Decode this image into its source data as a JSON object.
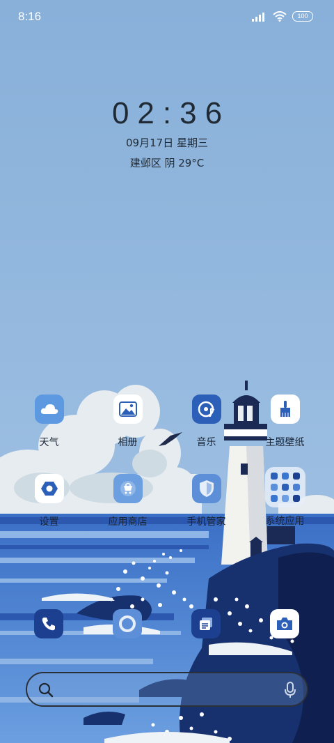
{
  "status_bar": {
    "time": "8:16",
    "battery": "100",
    "icons": [
      "signal-icon",
      "wifi-icon",
      "battery-icon"
    ]
  },
  "clock": {
    "time": "02:36",
    "date": "09月17日 星期三",
    "weather": "建邺区 阴 29°C"
  },
  "apps": [
    {
      "label": "天气",
      "icon": "cloud-icon"
    },
    {
      "label": "相册",
      "icon": "gallery-icon"
    },
    {
      "label": "音乐",
      "icon": "music-icon"
    },
    {
      "label": "主题壁纸",
      "icon": "brush-icon"
    },
    {
      "label": "设置",
      "icon": "hexagon-settings-icon"
    },
    {
      "label": "应用商店",
      "icon": "shopping-bag-icon"
    },
    {
      "label": "手机管家",
      "icon": "shield-icon"
    },
    {
      "label": "系统应用",
      "icon": "app-folder-icon"
    }
  ],
  "dock": [
    {
      "icon": "phone-icon"
    },
    {
      "icon": "browser-icon"
    },
    {
      "icon": "messages-icon"
    },
    {
      "icon": "camera-icon"
    }
  ],
  "search": {
    "icons": [
      "search-icon",
      "microphone-icon"
    ]
  },
  "colors": {
    "sky": "#8eb4db",
    "sea": "#3f73c9",
    "navy": "#17306e",
    "cloud": "#e8edef"
  }
}
